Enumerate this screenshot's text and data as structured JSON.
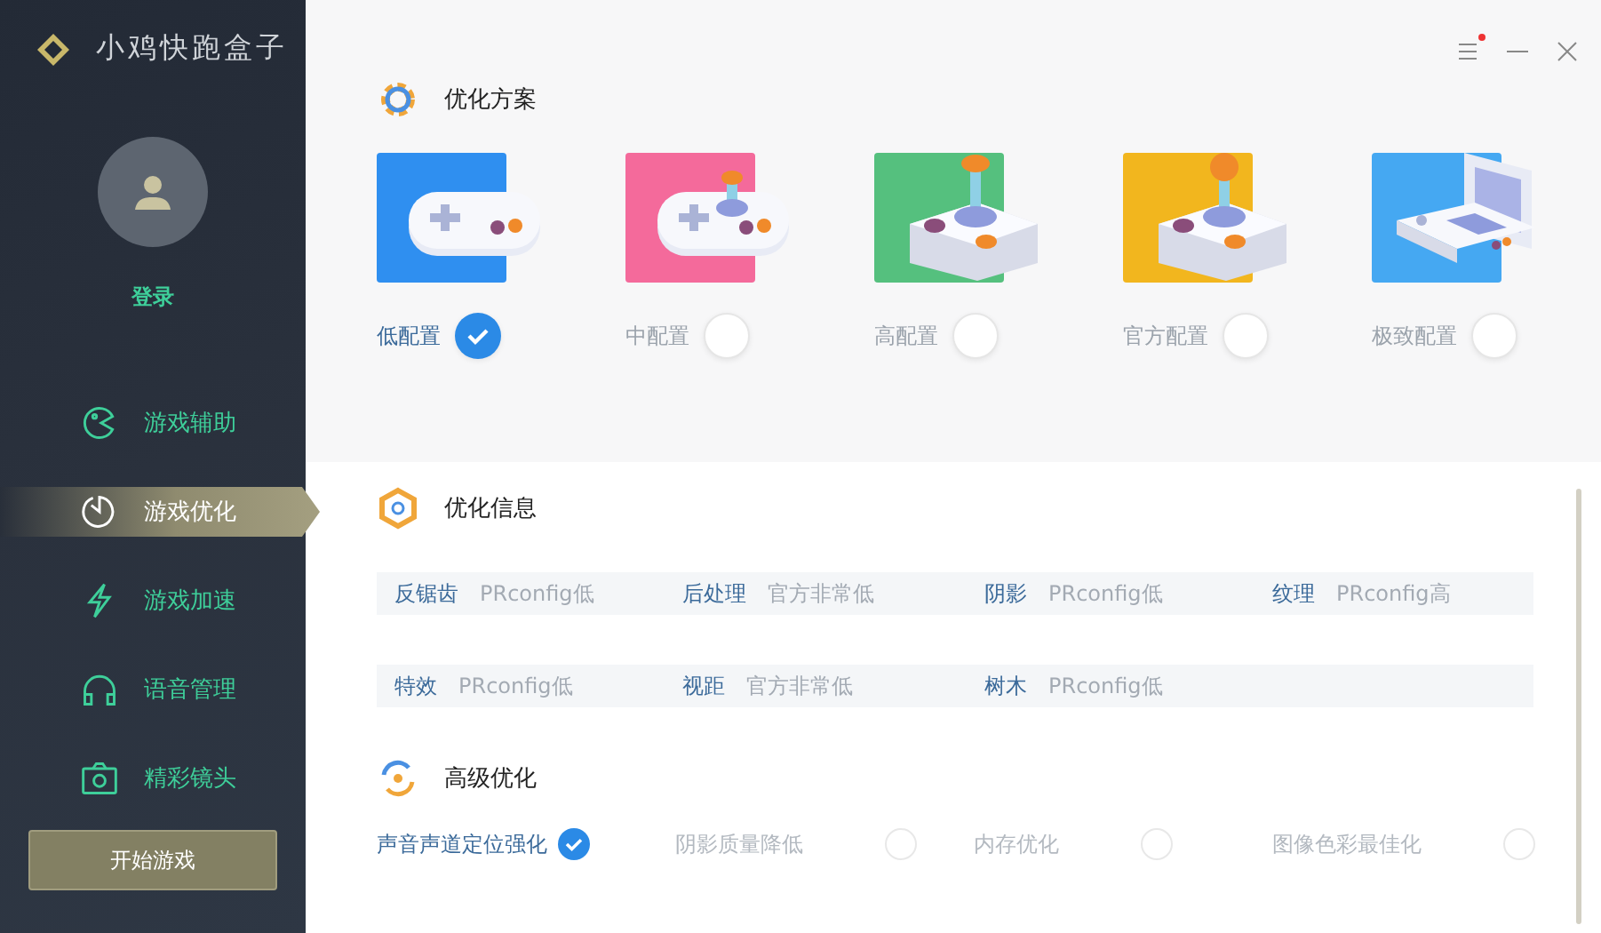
{
  "app": {
    "title": "小鸡快跑盒子"
  },
  "user": {
    "login": "登录"
  },
  "nav": [
    {
      "label": "游戏辅助",
      "kind": "pacman",
      "selected": false
    },
    {
      "label": "游戏优化",
      "kind": "clock",
      "selected": true
    },
    {
      "label": "游戏加速",
      "kind": "bolt",
      "selected": false
    },
    {
      "label": "语音管理",
      "kind": "headphones",
      "selected": false
    },
    {
      "label": "精彩镜头",
      "kind": "camera",
      "selected": false
    }
  ],
  "start_button": "开始游戏",
  "window_controls": {
    "notification": true
  },
  "plans": {
    "title": "优化方案",
    "items": [
      {
        "label": "低配置",
        "color": "#2f8ff0",
        "kind": "pad",
        "selected": true
      },
      {
        "label": "中配置",
        "color": "#f46a9b",
        "kind": "pad-stick",
        "selected": false
      },
      {
        "label": "高配置",
        "color": "#55c07e",
        "kind": "arcade",
        "selected": false
      },
      {
        "label": "官方配置",
        "color": "#f2b61e",
        "kind": "arcade-ball",
        "selected": false
      },
      {
        "label": "极致配置",
        "color": "#45a8f2",
        "kind": "handheld",
        "selected": false
      }
    ]
  },
  "info": {
    "title": "优化信息",
    "rows": [
      [
        {
          "label": "反锯齿",
          "value": "PRconfig低"
        },
        {
          "label": "后处理",
          "value": "官方非常低"
        },
        {
          "label": "阴影",
          "value": "PRconfig低"
        },
        {
          "label": "纹理",
          "value": "PRconfig高"
        }
      ],
      [
        {
          "label": "特效",
          "value": "PRconfig低"
        },
        {
          "label": "视距",
          "value": "官方非常低"
        },
        {
          "label": "树木",
          "value": "PRconfig低"
        }
      ]
    ]
  },
  "advanced": {
    "title": "高级优化",
    "items": [
      {
        "label": "声音声道定位强化",
        "checked": true
      },
      {
        "label": "阴影质量降低",
        "checked": false
      },
      {
        "label": "内存优化",
        "checked": false
      },
      {
        "label": "图像色彩最佳化",
        "checked": false
      }
    ]
  }
}
